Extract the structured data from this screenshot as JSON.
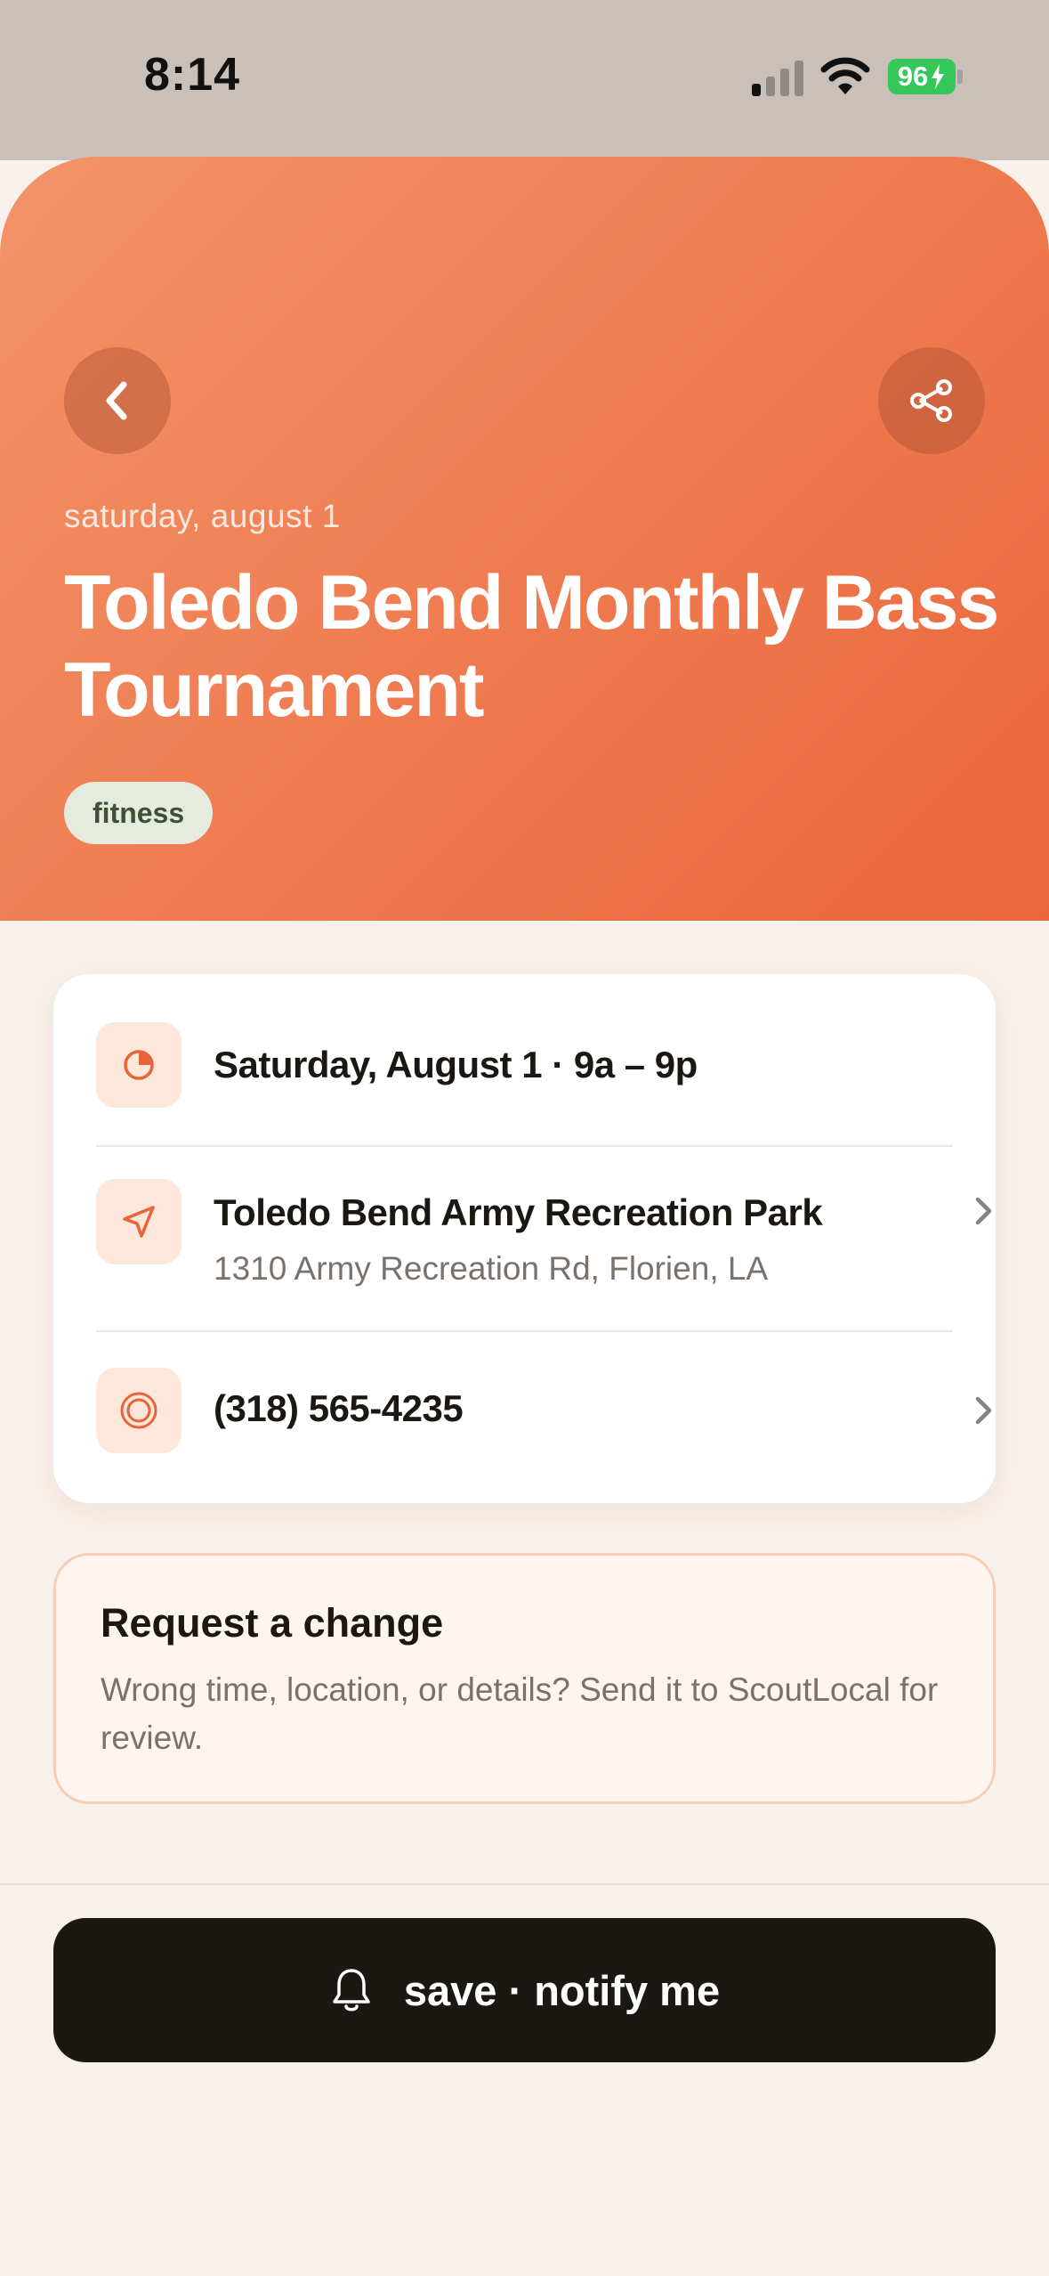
{
  "status_bar": {
    "time": "8:14",
    "battery": "96"
  },
  "hero": {
    "date_eyebrow": "saturday, august 1",
    "title": "Toledo Bend Monthly Bass Tournament",
    "tag": "fitness",
    "colors": {
      "gradient_start": "#f39468",
      "gradient_end": "#e9673b"
    }
  },
  "details": {
    "when": "Saturday, August 1 · 9a – 9p",
    "location_name": "Toledo Bend Army Recreation Park",
    "location_address": "1310 Army Recreation Rd, Florien, LA",
    "phone": "(318) 565-4235"
  },
  "request_change": {
    "title": "Request a change",
    "description": "Wrong time, location, or details? Send it to ScoutLocal for review."
  },
  "cta": {
    "label": "save · notify me"
  },
  "icons": [
    "chevron-left-icon",
    "share-icon",
    "clock-icon",
    "location-arrow-icon",
    "phone-icon",
    "chevron-right-icon",
    "bell-icon"
  ],
  "accent_color": "#e8643a"
}
